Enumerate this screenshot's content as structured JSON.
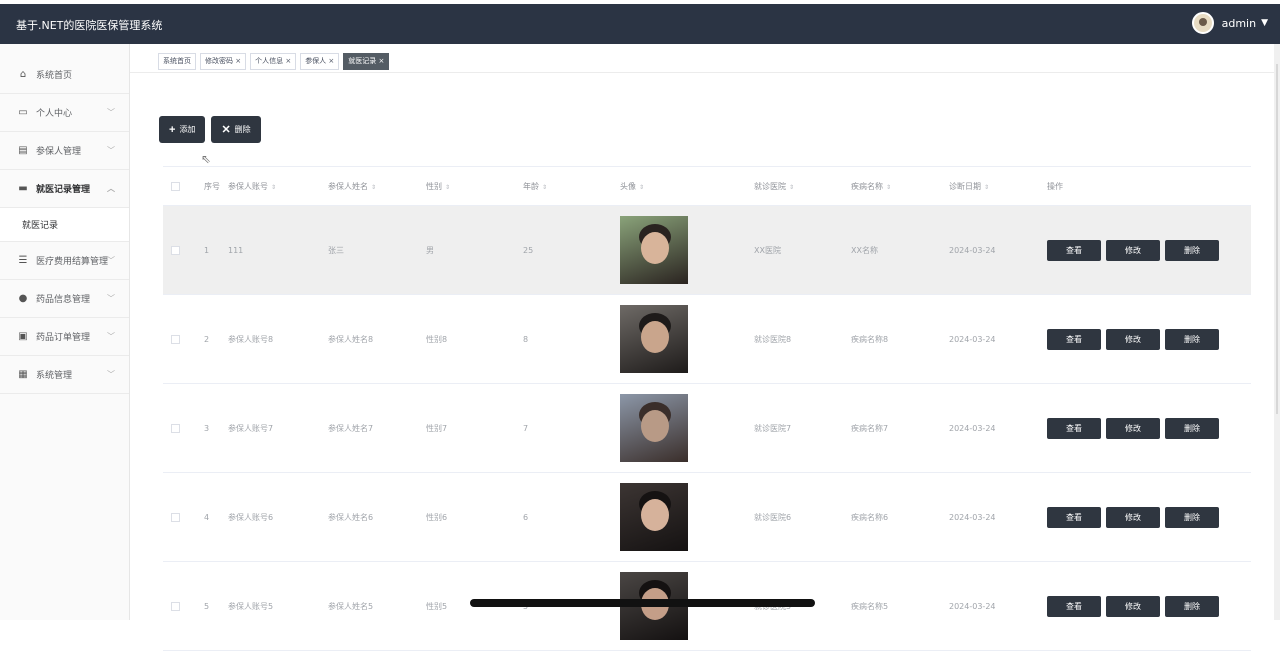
{
  "app": {
    "title": "基于.NET的医院医保管理系统",
    "username": "admin"
  },
  "sidebar": {
    "items": [
      {
        "label": "系统首页",
        "icon": "home-icon",
        "glyph": "⌂",
        "chevron": false,
        "active": false
      },
      {
        "label": "个人中心",
        "icon": "card-icon",
        "glyph": "▭",
        "chevron": true,
        "active": false
      },
      {
        "label": "参保人管理",
        "icon": "clipboard-icon",
        "glyph": "▤",
        "chevron": true,
        "active": false
      },
      {
        "label": "就医记录管理",
        "icon": "bed-icon",
        "glyph": "▬",
        "chevron": true,
        "active": true,
        "expanded": true
      },
      {
        "label": "医疗费用结算管理",
        "icon": "sliders-icon",
        "glyph": "☰",
        "chevron": true,
        "active": false
      },
      {
        "label": "药品信息管理",
        "icon": "user-icon",
        "glyph": "●",
        "chevron": true,
        "active": false
      },
      {
        "label": "药品订单管理",
        "icon": "receipt-icon",
        "glyph": "▣",
        "chevron": true,
        "active": false
      },
      {
        "label": "系统管理",
        "icon": "grid-icon",
        "glyph": "▦",
        "chevron": true,
        "active": false
      }
    ],
    "submenu": {
      "label": "就医记录"
    }
  },
  "tabs": [
    {
      "label": "系统首页",
      "closable": false,
      "active": false
    },
    {
      "label": "修改密码 ×",
      "closable": true,
      "active": false
    },
    {
      "label": "个人信息 ×",
      "closable": true,
      "active": false
    },
    {
      "label": "参保人 ×",
      "closable": true,
      "active": false
    },
    {
      "label": "就医记录 ×",
      "closable": true,
      "active": true
    }
  ],
  "toolbar": {
    "add_label": "添加",
    "delete_label": "删除",
    "add_glyph": "+",
    "delete_glyph": "✕"
  },
  "table": {
    "sort_glyph": "⇕",
    "headers": {
      "no": "序号",
      "account": "参保人账号",
      "name": "参保人姓名",
      "sex": "性别",
      "age": "年龄",
      "avatar": "头像",
      "hospital": "就诊医院",
      "disease": "疾病名称",
      "date": "诊断日期",
      "ops": "操作"
    },
    "rows": [
      {
        "no": "1",
        "account": "111",
        "name": "张三",
        "sex": "男",
        "age": "25",
        "hospital": "XX医院",
        "disease": "XX名称",
        "date": "2024-03-24",
        "hover": true
      },
      {
        "no": "2",
        "account": "参保人账号8",
        "name": "参保人姓名8",
        "sex": "性别8",
        "age": "8",
        "hospital": "就诊医院8",
        "disease": "疾病名称8",
        "date": "2024-03-24",
        "hover": false
      },
      {
        "no": "3",
        "account": "参保人账号7",
        "name": "参保人姓名7",
        "sex": "性别7",
        "age": "7",
        "hospital": "就诊医院7",
        "disease": "疾病名称7",
        "date": "2024-03-24",
        "hover": false
      },
      {
        "no": "4",
        "account": "参保人账号6",
        "name": "参保人姓名6",
        "sex": "性别6",
        "age": "6",
        "hospital": "就诊医院6",
        "disease": "疾病名称6",
        "date": "2024-03-24",
        "hover": false
      },
      {
        "no": "5",
        "account": "参保人账号5",
        "name": "参保人姓名5",
        "sex": "性别5",
        "age": "5",
        "hospital": "就诊医院5",
        "disease": "疾病名称5",
        "date": "2024-03-24",
        "hover": false
      }
    ],
    "row_actions": {
      "view": "查看",
      "edit": "修改",
      "delete": "删除"
    }
  },
  "colors": {
    "topbar": "#2b3444",
    "button": "#2f3640",
    "active_tab": "#545c64"
  },
  "photo_palettes": [
    {
      "bg": "#8aa37a",
      "face": "#d8b49a",
      "hair": "#2a2320"
    },
    {
      "bg": "#6e6a66",
      "face": "#c9a58c",
      "hair": "#1e1b1a"
    },
    {
      "bg": "#8c97a8",
      "face": "#b89a86",
      "hair": "#3a2e2a"
    },
    {
      "bg": "#3c3533",
      "face": "#d6b29b",
      "hair": "#151212"
    },
    {
      "bg": "#4a4644",
      "face": "#c49e88",
      "hair": "#141111"
    }
  ]
}
